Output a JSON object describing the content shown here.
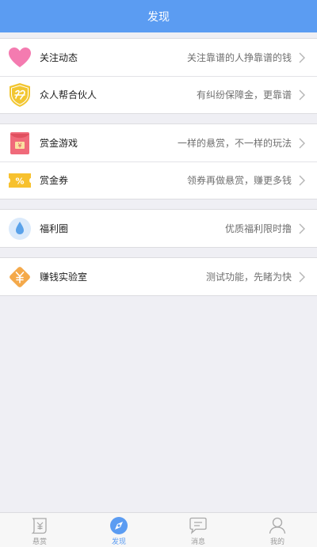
{
  "header": {
    "title": "发现"
  },
  "groups": [
    {
      "rows": [
        {
          "icon": "heart-icon",
          "title": "关注动态",
          "desc": "关注靠谱的人挣靠谱的钱"
        },
        {
          "icon": "partner-shield-icon",
          "title": "众人帮合伙人",
          "desc": "有纠纷保障金，更靠谱"
        }
      ]
    },
    {
      "rows": [
        {
          "icon": "red-envelope-icon",
          "title": "赏金游戏",
          "desc": "一样的悬赏，不一样的玩法"
        },
        {
          "icon": "coupon-icon",
          "title": "赏金券",
          "desc": "领券再做悬赏，赚更多钱"
        }
      ]
    },
    {
      "rows": [
        {
          "icon": "water-drop-icon",
          "title": "福利圈",
          "desc": "优质福利限时撸"
        }
      ]
    },
    {
      "rows": [
        {
          "icon": "yuan-diamond-icon",
          "title": "赚钱实验室",
          "desc": "测试功能，先睹为快"
        }
      ]
    }
  ],
  "tabbar": {
    "tabs": [
      {
        "icon": "reward-scroll-icon",
        "label": "悬赏"
      },
      {
        "icon": "discover-compass-icon",
        "label": "发现",
        "active": true
      },
      {
        "icon": "message-bubble-icon",
        "label": "消息"
      },
      {
        "icon": "person-icon",
        "label": "我的"
      }
    ]
  },
  "colors": {
    "accent": "#5b9cf2",
    "background": "#efeff4",
    "heart": "#f47bb0",
    "shield": "#f2c631",
    "envelope": "#f06a7a",
    "coupon": "#f7c12e",
    "drop": "#5aa2ea",
    "diamond": "#f4a94a"
  }
}
